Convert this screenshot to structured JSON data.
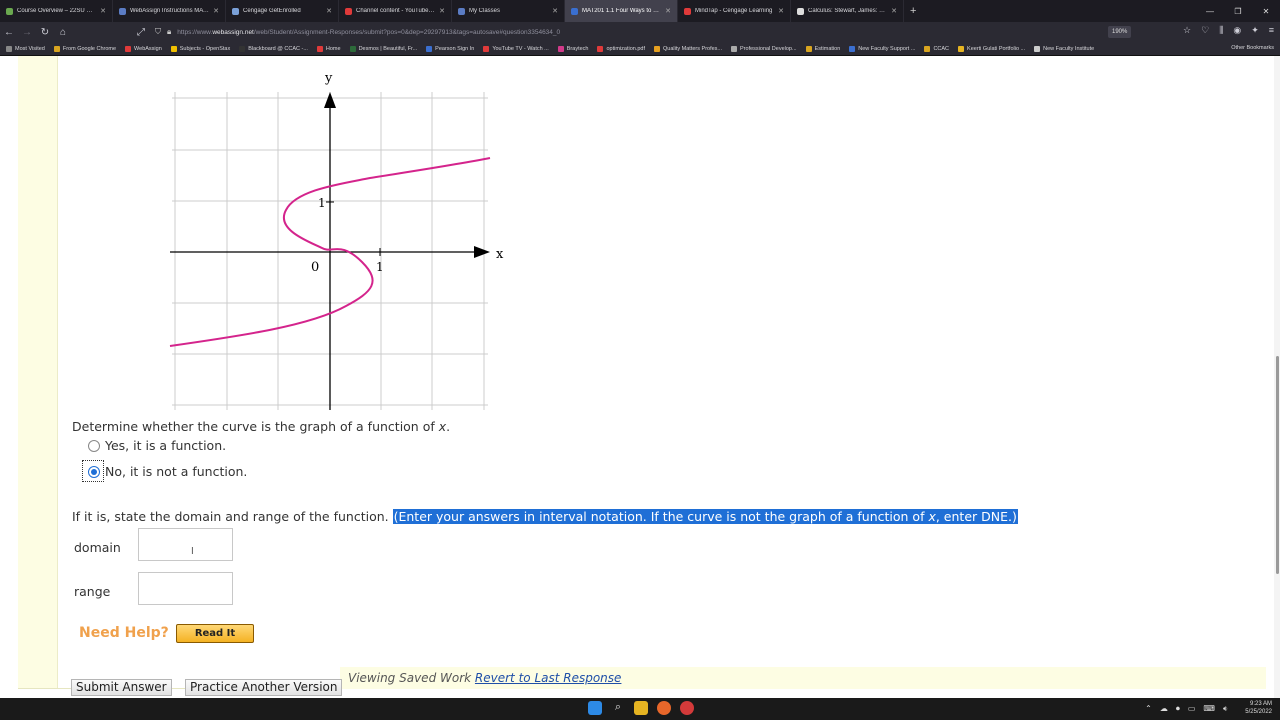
{
  "browser": {
    "tabs": [
      {
        "label": "Course Overview – 22SU Calcul...",
        "color": "#6aa84f",
        "active": false
      },
      {
        "label": "WebAssign Instructions MAT20...",
        "color": "#5b7cc4",
        "active": false
      },
      {
        "label": "Cengage GetEnrolled",
        "color": "#7aa0d8",
        "active": false
      },
      {
        "label": "Channel content - YouTube St...",
        "color": "#e03a3a",
        "active": false
      },
      {
        "label": "My Classes",
        "color": "#5b7cc4",
        "active": false
      },
      {
        "label": "MAT201 1.1 Four Ways to Repr...",
        "color": "#3a6fd0",
        "active": true
      },
      {
        "label": "MindTap - Cengage Learning",
        "color": "#e03a3a",
        "active": false
      },
      {
        "label": "Calculus: Stewart, James: 978...",
        "color": "#dddddd",
        "active": false
      }
    ],
    "url_prefix": "https://www.",
    "url_domain": "webassign.net",
    "url_rest": "/web/Student/Assignment-Responses/submit?pos=0&dep=29297913&tags=autosave#question3354634_0",
    "zoom": "190%",
    "bookmarks": [
      "Most Visited",
      "From Google Chrome",
      "WebAssign",
      "Subjects - OpenStax",
      "Blackboard @ CCAC -...",
      "Home",
      "Desmos | Beautiful, Fr...",
      "Pearson Sign In",
      "YouTube TV - Watch ...",
      "Braytech",
      "optimization.pdf",
      "Quality Matters Profes...",
      "Professional Develop...",
      "Estimation",
      "New Faculty Support ...",
      "CCAC",
      "Keerti Gulati Portfolio ...",
      "New Faculty Institute"
    ],
    "other_bookmarks": "Other Bookmarks"
  },
  "graph": {
    "x_axis_label": "x",
    "y_axis_label": "y",
    "origin_label": "0",
    "x_tick_label": "1",
    "y_tick_label": "1",
    "curve_color": "#d4248c"
  },
  "question": {
    "prompt_pre": "Determine whether the curve is the graph of a function of ",
    "prompt_var": "x",
    "prompt_post": ".",
    "option_yes": "Yes, it is a function.",
    "option_no": "No, it is not a function.",
    "selected": "no",
    "domain_prompt": "If it is, state the domain and range of the function.",
    "hint_pre": "(Enter your answers in interval notation. If the curve is not the graph of a function of ",
    "hint_var": "x",
    "hint_post": ", enter DNE.)",
    "domain_label": "domain",
    "range_label": "range",
    "domain_value": "",
    "range_value": ""
  },
  "help": {
    "need_help": "Need Help?",
    "read_it": "Read It"
  },
  "footer": {
    "submit": "Submit Answer",
    "practice": "Practice Another Version",
    "saved_text": "Viewing Saved Work",
    "revert": "Revert to Last Response"
  },
  "taskbar": {
    "time": "9:23 AM",
    "date": "5/25/2022"
  }
}
